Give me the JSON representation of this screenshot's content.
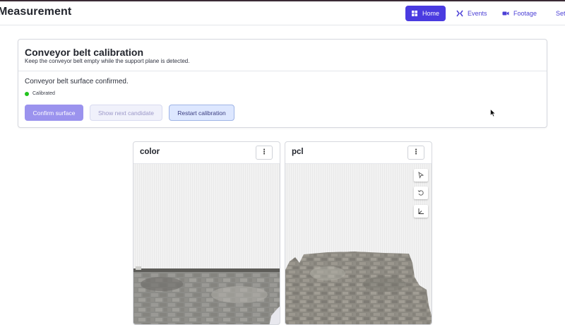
{
  "app": {
    "title": "Measurement"
  },
  "nav": {
    "home": "Home",
    "events": "Events",
    "footage": "Footage",
    "settings": "Settings",
    "active_color": "#4a3be0"
  },
  "calibration": {
    "title": "Conveyor belt calibration",
    "subtitle": "Keep the conveyor belt empty while the support plane is detected.",
    "message": "Conveyor belt surface confirmed.",
    "status": "Calibrated",
    "status_color": "#22c41d",
    "buttons": {
      "confirm": "Confirm surface",
      "next": "Show next candidate",
      "restart": "Restart calibration"
    }
  },
  "panels": {
    "color": {
      "title": "color"
    },
    "pcl": {
      "title": "pcl",
      "tools": [
        "select-icon",
        "reset-view-icon",
        "axes-icon"
      ]
    }
  }
}
